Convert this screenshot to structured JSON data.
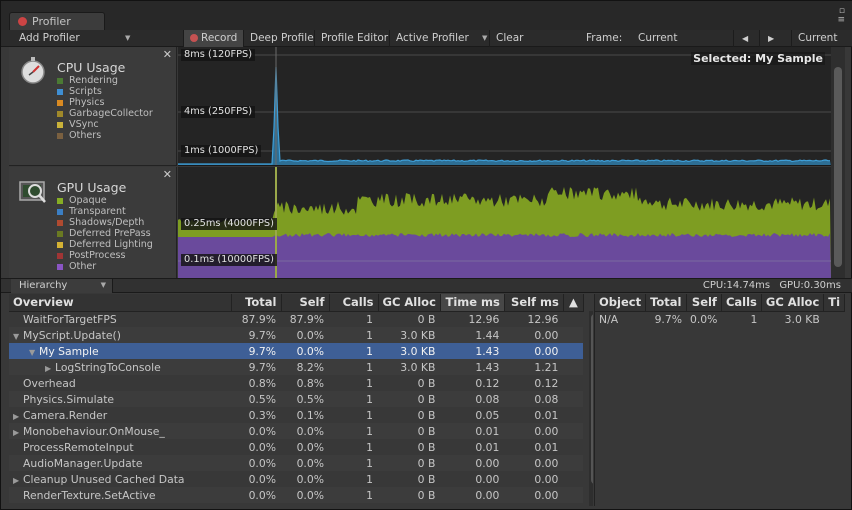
{
  "tab": {
    "title": "Profiler"
  },
  "toolbar": {
    "add_profiler": "Add Profiler",
    "record": "Record",
    "deep_profile": "Deep Profile",
    "profile_editor": "Profile Editor",
    "active_profiler": "Active Profiler",
    "clear": "Clear",
    "frame_label": "Frame:",
    "frame_value": "Current",
    "current_button": "Current"
  },
  "modules": {
    "cpu": {
      "title": "CPU Usage",
      "legend": [
        {
          "name": "Rendering",
          "color": "#4b7a34"
        },
        {
          "name": "Scripts",
          "color": "#3f8fd3"
        },
        {
          "name": "Physics",
          "color": "#d98a22"
        },
        {
          "name": "GarbageCollector",
          "color": "#a0892a"
        },
        {
          "name": "VSync",
          "color": "#c9b23a"
        },
        {
          "name": "Others",
          "color": "#7a6040"
        }
      ],
      "labels": [
        "8ms (120FPS)",
        "4ms (250FPS)",
        "1ms (1000FPS)"
      ],
      "selected": "Selected: My Sample"
    },
    "gpu": {
      "title": "GPU Usage",
      "legend": [
        {
          "name": "Opaque",
          "color": "#86ad24"
        },
        {
          "name": "Transparent",
          "color": "#3b7fc4"
        },
        {
          "name": "Shadows/Depth",
          "color": "#b04a30"
        },
        {
          "name": "Deferred PrePass",
          "color": "#6a7a22"
        },
        {
          "name": "Deferred Lighting",
          "color": "#d4b234"
        },
        {
          "name": "PostProcess",
          "color": "#a03535"
        },
        {
          "name": "Other",
          "color": "#8a55c4"
        }
      ],
      "labels": [
        "0.25ms (4000FPS)",
        "0.1ms (10000FPS)"
      ]
    }
  },
  "status": {
    "view": "Hierarchy",
    "cpu": "CPU:14.74ms",
    "gpu": "GPU:0.30ms"
  },
  "hierarchy": {
    "columns": [
      "Overview",
      "Total",
      "Self",
      "Calls",
      "GC Alloc",
      "Time ms",
      "Self ms",
      "▲"
    ],
    "rows": [
      {
        "name": "WaitForTargetFPS",
        "tri": "",
        "indent": 0,
        "total": "87.9%",
        "self": "87.9%",
        "calls": "1",
        "gc": "0 B",
        "time": "12.96",
        "selfms": "12.96"
      },
      {
        "name": "MyScript.Update()",
        "tri": "▼",
        "indent": 0,
        "total": "9.7%",
        "self": "0.0%",
        "calls": "1",
        "gc": "3.0 KB",
        "time": "1.44",
        "selfms": "0.00"
      },
      {
        "name": "My Sample",
        "tri": "▼",
        "indent": 1,
        "total": "9.7%",
        "self": "0.0%",
        "calls": "1",
        "gc": "3.0 KB",
        "time": "1.43",
        "selfms": "0.00",
        "selected": true
      },
      {
        "name": "LogStringToConsole",
        "tri": "▶",
        "indent": 2,
        "total": "9.7%",
        "self": "8.2%",
        "calls": "1",
        "gc": "3.0 KB",
        "time": "1.43",
        "selfms": "1.21"
      },
      {
        "name": "Overhead",
        "tri": "",
        "indent": 0,
        "total": "0.8%",
        "self": "0.8%",
        "calls": "1",
        "gc": "0 B",
        "time": "0.12",
        "selfms": "0.12"
      },
      {
        "name": "Physics.Simulate",
        "tri": "",
        "indent": 0,
        "total": "0.5%",
        "self": "0.5%",
        "calls": "1",
        "gc": "0 B",
        "time": "0.08",
        "selfms": "0.08"
      },
      {
        "name": "Camera.Render",
        "tri": "▶",
        "indent": 0,
        "total": "0.3%",
        "self": "0.1%",
        "calls": "1",
        "gc": "0 B",
        "time": "0.05",
        "selfms": "0.01"
      },
      {
        "name": "Monobehaviour.OnMouse_",
        "tri": "▶",
        "indent": 0,
        "total": "0.0%",
        "self": "0.0%",
        "calls": "1",
        "gc": "0 B",
        "time": "0.01",
        "selfms": "0.00"
      },
      {
        "name": "ProcessRemoteInput",
        "tri": "",
        "indent": 0,
        "total": "0.0%",
        "self": "0.0%",
        "calls": "1",
        "gc": "0 B",
        "time": "0.01",
        "selfms": "0.01"
      },
      {
        "name": "AudioManager.Update",
        "tri": "",
        "indent": 0,
        "total": "0.0%",
        "self": "0.0%",
        "calls": "1",
        "gc": "0 B",
        "time": "0.00",
        "selfms": "0.00"
      },
      {
        "name": "Cleanup Unused Cached Data",
        "tri": "▶",
        "indent": 0,
        "total": "0.0%",
        "self": "0.0%",
        "calls": "1",
        "gc": "0 B",
        "time": "0.00",
        "selfms": "0.00"
      },
      {
        "name": "RenderTexture.SetActive",
        "tri": "",
        "indent": 0,
        "total": "0.0%",
        "self": "0.0%",
        "calls": "1",
        "gc": "0 B",
        "time": "0.00",
        "selfms": "0.00"
      }
    ]
  },
  "details": {
    "columns": [
      "Object",
      "Total",
      "Self",
      "Calls",
      "GC Alloc",
      "Ti"
    ],
    "rows": [
      {
        "object": "N/A",
        "total": "9.7%",
        "self": "0.0%",
        "calls": "1",
        "gc": "3.0 KB",
        "ti": ""
      }
    ]
  }
}
